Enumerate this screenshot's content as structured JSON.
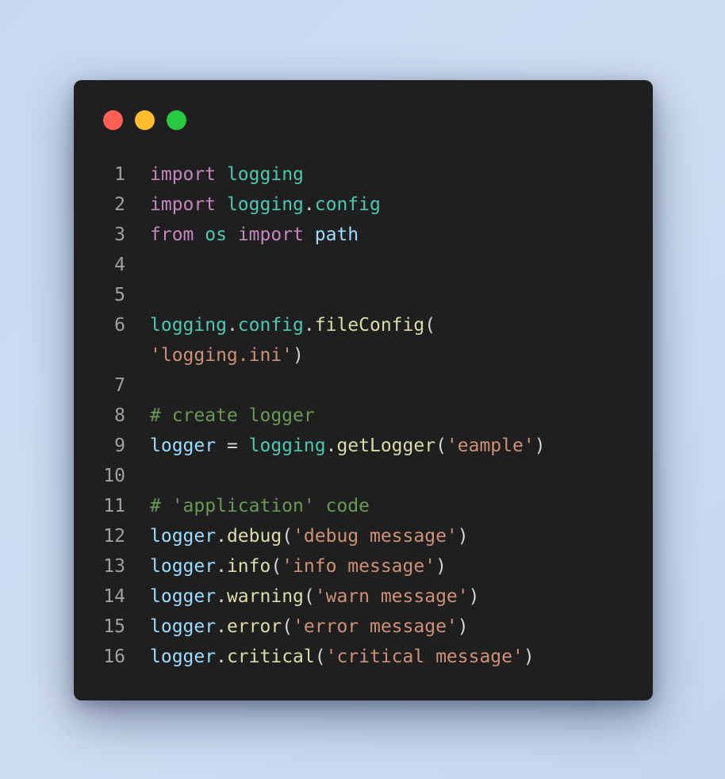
{
  "colors": {
    "background": "#c9daf0",
    "window": "#1f1f1f",
    "dot_red": "#fe5f57",
    "dot_yellow": "#febc2e",
    "dot_green": "#28c840",
    "line_number": "#a0a0a0",
    "keyword": "#c586c0",
    "module": "#4ec9b0",
    "identifier": "#9cdcfe",
    "function": "#dcdcaa",
    "string": "#ce9178",
    "comment": "#6a9955",
    "punctuation": "#d4d4d4"
  },
  "window_controls": [
    {
      "name": "close-dot",
      "color": "#fe5f57"
    },
    {
      "name": "minimize-dot",
      "color": "#febc2e"
    },
    {
      "name": "maximize-dot",
      "color": "#28c840"
    }
  ],
  "code_lines": [
    {
      "number": "1",
      "tokens": [
        {
          "t": "import",
          "k": "keyword"
        },
        {
          "t": " ",
          "k": "punct"
        },
        {
          "t": "logging",
          "k": "module"
        }
      ]
    },
    {
      "number": "2",
      "tokens": [
        {
          "t": "import",
          "k": "keyword"
        },
        {
          "t": " ",
          "k": "punct"
        },
        {
          "t": "logging",
          "k": "module"
        },
        {
          "t": ".",
          "k": "punct"
        },
        {
          "t": "config",
          "k": "module"
        }
      ]
    },
    {
      "number": "3",
      "tokens": [
        {
          "t": "from",
          "k": "keyword"
        },
        {
          "t": " ",
          "k": "punct"
        },
        {
          "t": "os",
          "k": "module"
        },
        {
          "t": " ",
          "k": "punct"
        },
        {
          "t": "import",
          "k": "keyword"
        },
        {
          "t": " ",
          "k": "punct"
        },
        {
          "t": "path",
          "k": "ident"
        }
      ]
    },
    {
      "number": "4",
      "tokens": []
    },
    {
      "number": "5",
      "tokens": []
    },
    {
      "number": "6",
      "tokens": [
        {
          "t": "logging",
          "k": "module"
        },
        {
          "t": ".",
          "k": "punct"
        },
        {
          "t": "config",
          "k": "module"
        },
        {
          "t": ".",
          "k": "punct"
        },
        {
          "t": "fileConfig",
          "k": "func"
        },
        {
          "t": "(",
          "k": "punct"
        }
      ]
    },
    {
      "number": "",
      "tokens": [
        {
          "t": "'logging.ini'",
          "k": "string"
        },
        {
          "t": ")",
          "k": "punct"
        }
      ]
    },
    {
      "number": "7",
      "tokens": []
    },
    {
      "number": "8",
      "tokens": [
        {
          "t": "# create logger",
          "k": "comment"
        }
      ]
    },
    {
      "number": "9",
      "tokens": [
        {
          "t": "logger",
          "k": "ident"
        },
        {
          "t": " = ",
          "k": "op"
        },
        {
          "t": "logging",
          "k": "module"
        },
        {
          "t": ".",
          "k": "punct"
        },
        {
          "t": "getLogger",
          "k": "func"
        },
        {
          "t": "(",
          "k": "punct"
        },
        {
          "t": "'eample'",
          "k": "string"
        },
        {
          "t": ")",
          "k": "punct"
        }
      ]
    },
    {
      "number": "10",
      "tokens": []
    },
    {
      "number": "11",
      "tokens": [
        {
          "t": "# 'application' code",
          "k": "comment"
        }
      ]
    },
    {
      "number": "12",
      "tokens": [
        {
          "t": "logger",
          "k": "ident"
        },
        {
          "t": ".",
          "k": "punct"
        },
        {
          "t": "debug",
          "k": "func"
        },
        {
          "t": "(",
          "k": "punct"
        },
        {
          "t": "'debug message'",
          "k": "string"
        },
        {
          "t": ")",
          "k": "punct"
        }
      ]
    },
    {
      "number": "13",
      "tokens": [
        {
          "t": "logger",
          "k": "ident"
        },
        {
          "t": ".",
          "k": "punct"
        },
        {
          "t": "info",
          "k": "func"
        },
        {
          "t": "(",
          "k": "punct"
        },
        {
          "t": "'info message'",
          "k": "string"
        },
        {
          "t": ")",
          "k": "punct"
        }
      ]
    },
    {
      "number": "14",
      "tokens": [
        {
          "t": "logger",
          "k": "ident"
        },
        {
          "t": ".",
          "k": "punct"
        },
        {
          "t": "warning",
          "k": "func"
        },
        {
          "t": "(",
          "k": "punct"
        },
        {
          "t": "'warn message'",
          "k": "string"
        },
        {
          "t": ")",
          "k": "punct"
        }
      ]
    },
    {
      "number": "15",
      "tokens": [
        {
          "t": "logger",
          "k": "ident"
        },
        {
          "t": ".",
          "k": "punct"
        },
        {
          "t": "error",
          "k": "func"
        },
        {
          "t": "(",
          "k": "punct"
        },
        {
          "t": "'error message'",
          "k": "string"
        },
        {
          "t": ")",
          "k": "punct"
        }
      ]
    },
    {
      "number": "16",
      "tokens": [
        {
          "t": "logger",
          "k": "ident"
        },
        {
          "t": ".",
          "k": "punct"
        },
        {
          "t": "critical",
          "k": "func"
        },
        {
          "t": "(",
          "k": "punct"
        },
        {
          "t": "'critical message'",
          "k": "string"
        },
        {
          "t": ")",
          "k": "punct"
        }
      ]
    }
  ]
}
